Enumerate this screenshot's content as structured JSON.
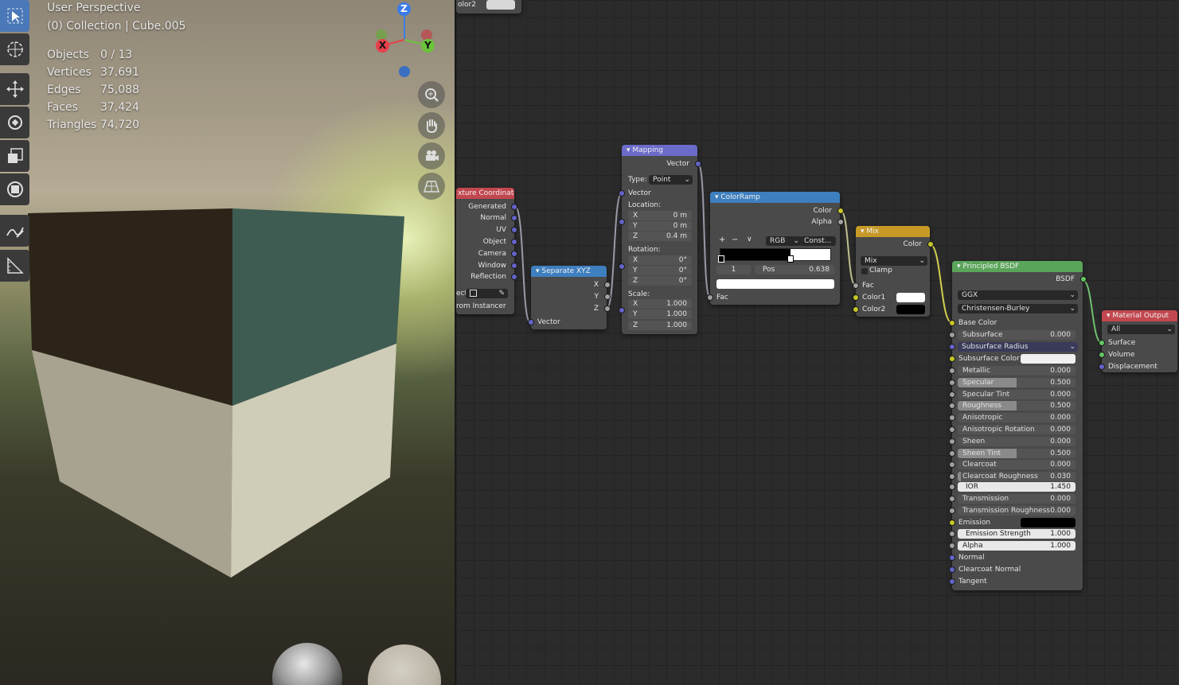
{
  "viewport": {
    "title": "User Perspective",
    "collection": "(0) Collection | Cube.005",
    "stats": [
      {
        "label": "Objects",
        "value": "0 / 13"
      },
      {
        "label": "Vertices",
        "value": "37,691"
      },
      {
        "label": "Edges",
        "value": "75,088"
      },
      {
        "label": "Faces",
        "value": "37,424"
      },
      {
        "label": "Triangles",
        "value": "74,720"
      }
    ],
    "gizmo": {
      "z": "Z",
      "x": "X",
      "y": "Y"
    }
  },
  "nodes": {
    "top_partial": {
      "label": "olor2"
    },
    "tex_coord": {
      "title": "xture Coordinate",
      "outputs": [
        "Generated",
        "Normal",
        "UV",
        "Object",
        "Camera",
        "Window",
        "Reflection"
      ],
      "object_label": "ect",
      "from_instancer": "rom Instancer"
    },
    "separate_xyz": {
      "title": "Separate XYZ",
      "outputs": [
        "X",
        "Y",
        "Z"
      ],
      "input": "Vector"
    },
    "mapping": {
      "title": "Mapping",
      "output": "Vector",
      "type_label": "Type:",
      "type_value": "Point",
      "input": "Vector",
      "location_label": "Location:",
      "location": [
        {
          "axis": "X",
          "value": "0 m"
        },
        {
          "axis": "Y",
          "value": "0 m"
        },
        {
          "axis": "Z",
          "value": "0.4 m"
        }
      ],
      "rotation_label": "Rotation:",
      "rotation": [
        {
          "axis": "X",
          "value": "0°"
        },
        {
          "axis": "Y",
          "value": "0°"
        },
        {
          "axis": "Z",
          "value": "0°"
        }
      ],
      "scale_label": "Scale:",
      "scale": [
        {
          "axis": "X",
          "value": "1.000"
        },
        {
          "axis": "Y",
          "value": "1.000"
        },
        {
          "axis": "Z",
          "value": "1.000"
        }
      ]
    },
    "color_ramp": {
      "title": "ColorRamp",
      "outputs": [
        "Color",
        "Alpha"
      ],
      "add": "+",
      "remove": "−",
      "menu": "∨",
      "color_mode": "RGB",
      "interpolation": "Const...",
      "stop_index": "1",
      "pos_label": "Pos",
      "pos_value": "0.638",
      "input": "Fac",
      "stop_position": 0.638
    },
    "mix": {
      "title": "Mix",
      "output": "Color",
      "blend": "Mix",
      "clamp": "Clamp",
      "inputs": [
        "Fac",
        "Color1",
        "Color2"
      ]
    },
    "principled": {
      "title": "Principled BSDF",
      "output": "BSDF",
      "distribution": "GGX",
      "subsurface_method": "Christensen-Burley",
      "base_color": "Base Color",
      "subsurface": {
        "label": "Subsurface",
        "value": "0.000"
      },
      "subsurface_radius": "Subsurface Radius",
      "subsurface_color": "Subsurface Color",
      "params": [
        {
          "label": "Metallic",
          "value": "0.000",
          "fraction": 0
        },
        {
          "label": "Specular",
          "value": "0.500",
          "fraction": 0.5
        },
        {
          "label": "Specular Tint",
          "value": "0.000",
          "fraction": 0
        },
        {
          "label": "Roughness",
          "value": "0.500",
          "fraction": 0.5
        },
        {
          "label": "Anisotropic",
          "value": "0.000",
          "fraction": 0
        },
        {
          "label": "Anisotropic Rotation",
          "value": "0.000",
          "fraction": 0
        },
        {
          "label": "Sheen",
          "value": "0.000",
          "fraction": 0
        },
        {
          "label": "Sheen Tint",
          "value": "0.500",
          "fraction": 0.5
        },
        {
          "label": "Clearcoat",
          "value": "0.000",
          "fraction": 0
        },
        {
          "label": "Clearcoat Roughness",
          "value": "0.030",
          "fraction": 0.03
        }
      ],
      "ior": {
        "label": "IOR",
        "value": "1.450"
      },
      "transmission": {
        "label": "Transmission",
        "value": "0.000"
      },
      "transmission_roughness": {
        "label": "Transmission Roughness",
        "value": "0.000"
      },
      "emission": "Emission",
      "emission_strength": {
        "label": "Emission Strength",
        "value": "1.000"
      },
      "alpha": {
        "label": "Alpha",
        "value": "1.000"
      },
      "normal": "Normal",
      "clearcoat_normal": "Clearcoat Normal",
      "tangent": "Tangent"
    },
    "material_output": {
      "title": "Material Output",
      "target": "All",
      "inputs": [
        "Surface",
        "Volume",
        "Displacement"
      ]
    }
  },
  "colors": {
    "header_input": "#c2474f",
    "header_vector": "#3e7fbf",
    "header_converter": "#6b6bc9",
    "header_color": "#c79a28",
    "header_shader": "#5aa55a",
    "header_output": "#c2474f",
    "accent": "#4a78b8"
  }
}
